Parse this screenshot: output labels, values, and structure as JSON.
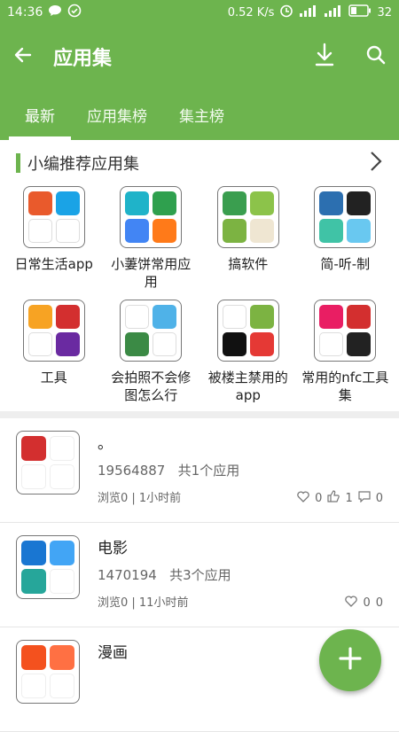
{
  "status_bar": {
    "time": "14:36",
    "net_speed": "0.52 K/s",
    "battery": "32"
  },
  "app_bar": {
    "title": "应用集"
  },
  "tabs": [
    {
      "label": "最新"
    },
    {
      "label": "应用集榜"
    },
    {
      "label": "集主榜"
    }
  ],
  "recommend": {
    "title": "小编推荐应用集",
    "items": [
      {
        "label": "日常生活app",
        "tiles": [
          "#e95a2c",
          "#1aa3e6",
          "#ffffff",
          "#ffffff"
        ]
      },
      {
        "label": "小萋饼常用应用",
        "tiles": [
          "#1fb3c9",
          "#2fa04e",
          "#4285f4",
          "#ff7a19"
        ]
      },
      {
        "label": "搞软件",
        "tiles": [
          "#3a9e4f",
          "#8cc34a",
          "#7cb342",
          "#efe6d2"
        ]
      },
      {
        "label": "简-听-制",
        "tiles": [
          "#2c6fb0",
          "#222222",
          "#40c3a6",
          "#69c8f0"
        ]
      },
      {
        "label": "工具",
        "tiles": [
          "#f7a323",
          "#d32f2f",
          "#ffffff",
          "#6a2aa1"
        ]
      },
      {
        "label": "会拍照不会修图怎么行",
        "tiles": [
          "#ffffff",
          "#4fb2e8",
          "#3b8a45",
          "#ffffff"
        ]
      },
      {
        "label": "被楼主禁用的app",
        "tiles": [
          "#ffffff",
          "#7cb342",
          "#111111",
          "#e53935"
        ]
      },
      {
        "label": "常用的nfc工具集",
        "tiles": [
          "#e91e63",
          "#d32f2f",
          "#ffffff",
          "#222222"
        ]
      }
    ]
  },
  "collections": [
    {
      "name": "。",
      "id": "19564887",
      "count": "共1个应用",
      "meta": "浏览0 | 1小时前",
      "likes": "0",
      "thumbs": "1",
      "comments": "0",
      "tiles": [
        "#d32f2f",
        "#ffffff",
        "#ffffff",
        "#ffffff"
      ]
    },
    {
      "name": "电影",
      "id": "1470194",
      "count": "共3个应用",
      "meta": "浏览0 | 11小时前",
      "likes": "0",
      "thumbs": "",
      "comments": "0",
      "tiles": [
        "#1976d2",
        "#42a5f5",
        "#26a69a",
        "#ffffff"
      ]
    },
    {
      "name": "漫画",
      "id": "",
      "count": "",
      "meta": "",
      "likes": "",
      "thumbs": "",
      "comments": "",
      "tiles": [
        "#f4511e",
        "#ff7043",
        "#ffffff",
        "#ffffff"
      ]
    }
  ],
  "fab": {
    "icon": "plus-icon"
  },
  "colors": {
    "primary": "#6db44e"
  }
}
